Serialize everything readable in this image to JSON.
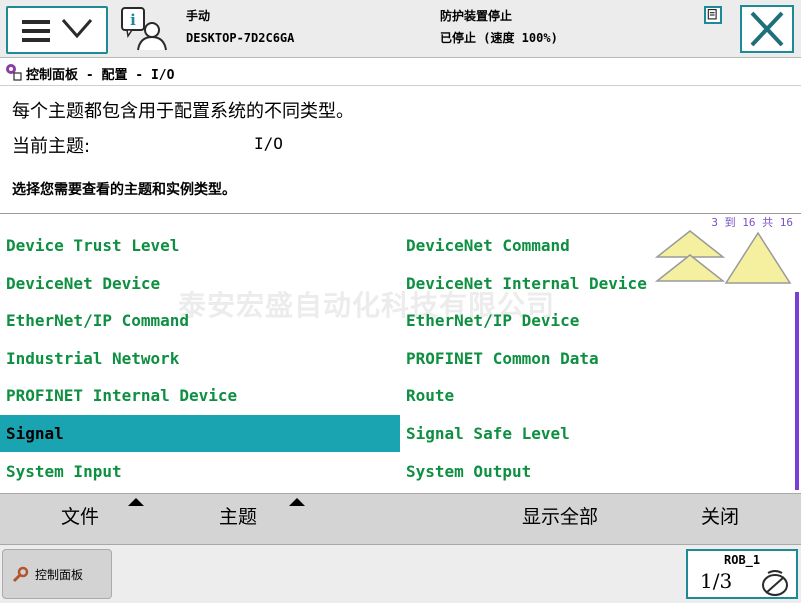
{
  "topbar": {
    "mode": "手动",
    "system_name": "DESKTOP-7D2C6GA",
    "safety_status": "防护装置停止",
    "run_status": "已停止 (速度 100%)"
  },
  "breadcrumb": "控制面板 - 配置 - I/O",
  "info": {
    "description": "每个主题都包含用于配置系统的不同类型。",
    "topic_label": "当前主题:",
    "topic_value": "I/O",
    "instruction": "选择您需要查看的主题和实例类型。"
  },
  "list": {
    "counter": "3 到 16 共 16",
    "watermark": "泰安宏盛自动化科技有限公司",
    "items": [
      {
        "label": "Device Trust Level"
      },
      {
        "label": "DeviceNet Command"
      },
      {
        "label": "DeviceNet Device"
      },
      {
        "label": "DeviceNet Internal Device"
      },
      {
        "label": "EtherNet/IP Command"
      },
      {
        "label": "EtherNet/IP Device"
      },
      {
        "label": "Industrial Network"
      },
      {
        "label": "PROFINET Common Data"
      },
      {
        "label": "PROFINET Internal Device"
      },
      {
        "label": "Route"
      },
      {
        "label": "Signal",
        "selected": true
      },
      {
        "label": "Signal Safe Level"
      },
      {
        "label": "System Input"
      },
      {
        "label": "System Output"
      }
    ]
  },
  "commands": {
    "file": "文件",
    "topic": "主题",
    "show_all": "显示全部",
    "close": "关闭"
  },
  "bottombar": {
    "task_label": "控制面板",
    "rob_label": "ROB_1",
    "rob_fraction": "1/3"
  },
  "colors": {
    "accent": "#1d8a97",
    "item_text": "#0e8f41",
    "selected_bg": "#1aa3b0",
    "counter": "#7a4fc4",
    "scrollbar": "#7b3fd6"
  }
}
